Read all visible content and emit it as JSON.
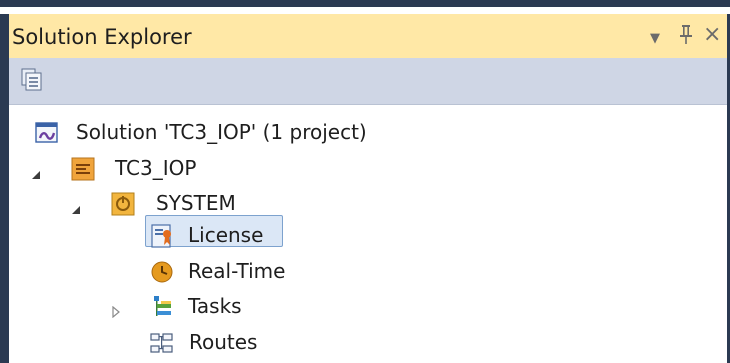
{
  "window": {
    "title": "Solution Explorer",
    "dropdown_glyph": "▼",
    "pin_glyph": "Ҭ",
    "close_glyph": "×"
  },
  "toolbar": {
    "icon": "properties-icon"
  },
  "tree": {
    "solution": {
      "label": "Solution 'TC3_IOP' (1 project)",
      "icon": "solution-icon"
    },
    "project": {
      "label": "TC3_IOP",
      "icon": "project-icon",
      "expanded": true
    },
    "system": {
      "label": "SYSTEM",
      "icon": "system-icon",
      "expanded": true
    },
    "license": {
      "label": "License",
      "icon": "license-icon",
      "selected": true
    },
    "realtime": {
      "label": "Real-Time",
      "icon": "realtime-icon"
    },
    "tasks": {
      "label": "Tasks",
      "icon": "tasks-icon",
      "expanded": false
    },
    "routes": {
      "label": "Routes",
      "icon": "routes-icon"
    }
  },
  "colors": {
    "title_bar": "#ffe8a6",
    "toolbar": "#cfd6e5",
    "frame": "#2b3a52",
    "selection": "#dbe7f6"
  }
}
